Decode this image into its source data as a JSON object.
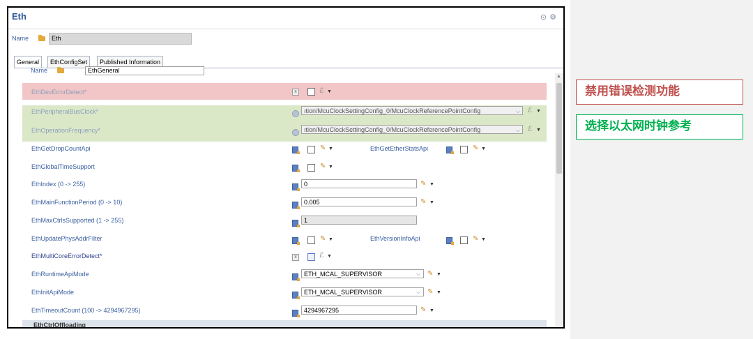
{
  "window": {
    "title": "Eth"
  },
  "name_row": {
    "label": "Name",
    "value": "Eth"
  },
  "tabs": [
    {
      "label": "General"
    },
    {
      "label": "EthConfigSet"
    },
    {
      "label": "Published Information"
    }
  ],
  "general": {
    "name_label": "Name",
    "name_value": "EthGeneral"
  },
  "params": {
    "dev_error_detect": "EthDevErrorDetect*",
    "peripheral_bus_clock": "EthPeripheralBusClock*",
    "peripheral_bus_clock_value": "ıtion/McuClockSettingConfig_0/McuClockReferencePointConfig",
    "operation_frequency": "EthOperationFrequency*",
    "operation_frequency_value": "ıtion/McuClockSettingConfig_0/McuClockReferencePointConfig",
    "get_drop_count_api": "EthGetDropCountApi",
    "get_ether_stats_api": "EthGetEtherStatsApi",
    "global_time_support": "EthGlobalTimeSupport",
    "index": "EthIndex (0 -> 255)",
    "index_value": "0",
    "main_function_period": "EthMainFunctionPeriod (0 -> 10)",
    "main_function_period_value": "0.005",
    "max_ctrls_supported": "EthMaxCtrlsSupported (1 -> 255)",
    "max_ctrls_supported_value": "1",
    "update_phys_addr_filter": "EthUpdatePhysAddrFilter",
    "version_info_api": "EthVersionInfoApi",
    "multicore_error_detect": "EthMultiCoreErrorDetect*",
    "runtime_api_mode": "EthRuntimeApiMode",
    "runtime_api_mode_value": "ETH_MCAL_SUPERVISOR",
    "init_api_mode": "EthInitApiMode",
    "init_api_mode_value": "ETH_MCAL_SUPERVISOR",
    "timeout_count": "EthTimeoutCount (100 -> 4294967295)",
    "timeout_count_value": "4294967295",
    "ctrl_offloading": "EthCtrlOffloading"
  },
  "annotations": {
    "red": "禁用错误检测功能",
    "green": "选择以太网时钟参考"
  },
  "colors": {
    "red_band": "#f2c6c6",
    "green_band": "#dbe8c8",
    "red_annotation": "#c0504d",
    "green_annotation": "#00b050"
  }
}
